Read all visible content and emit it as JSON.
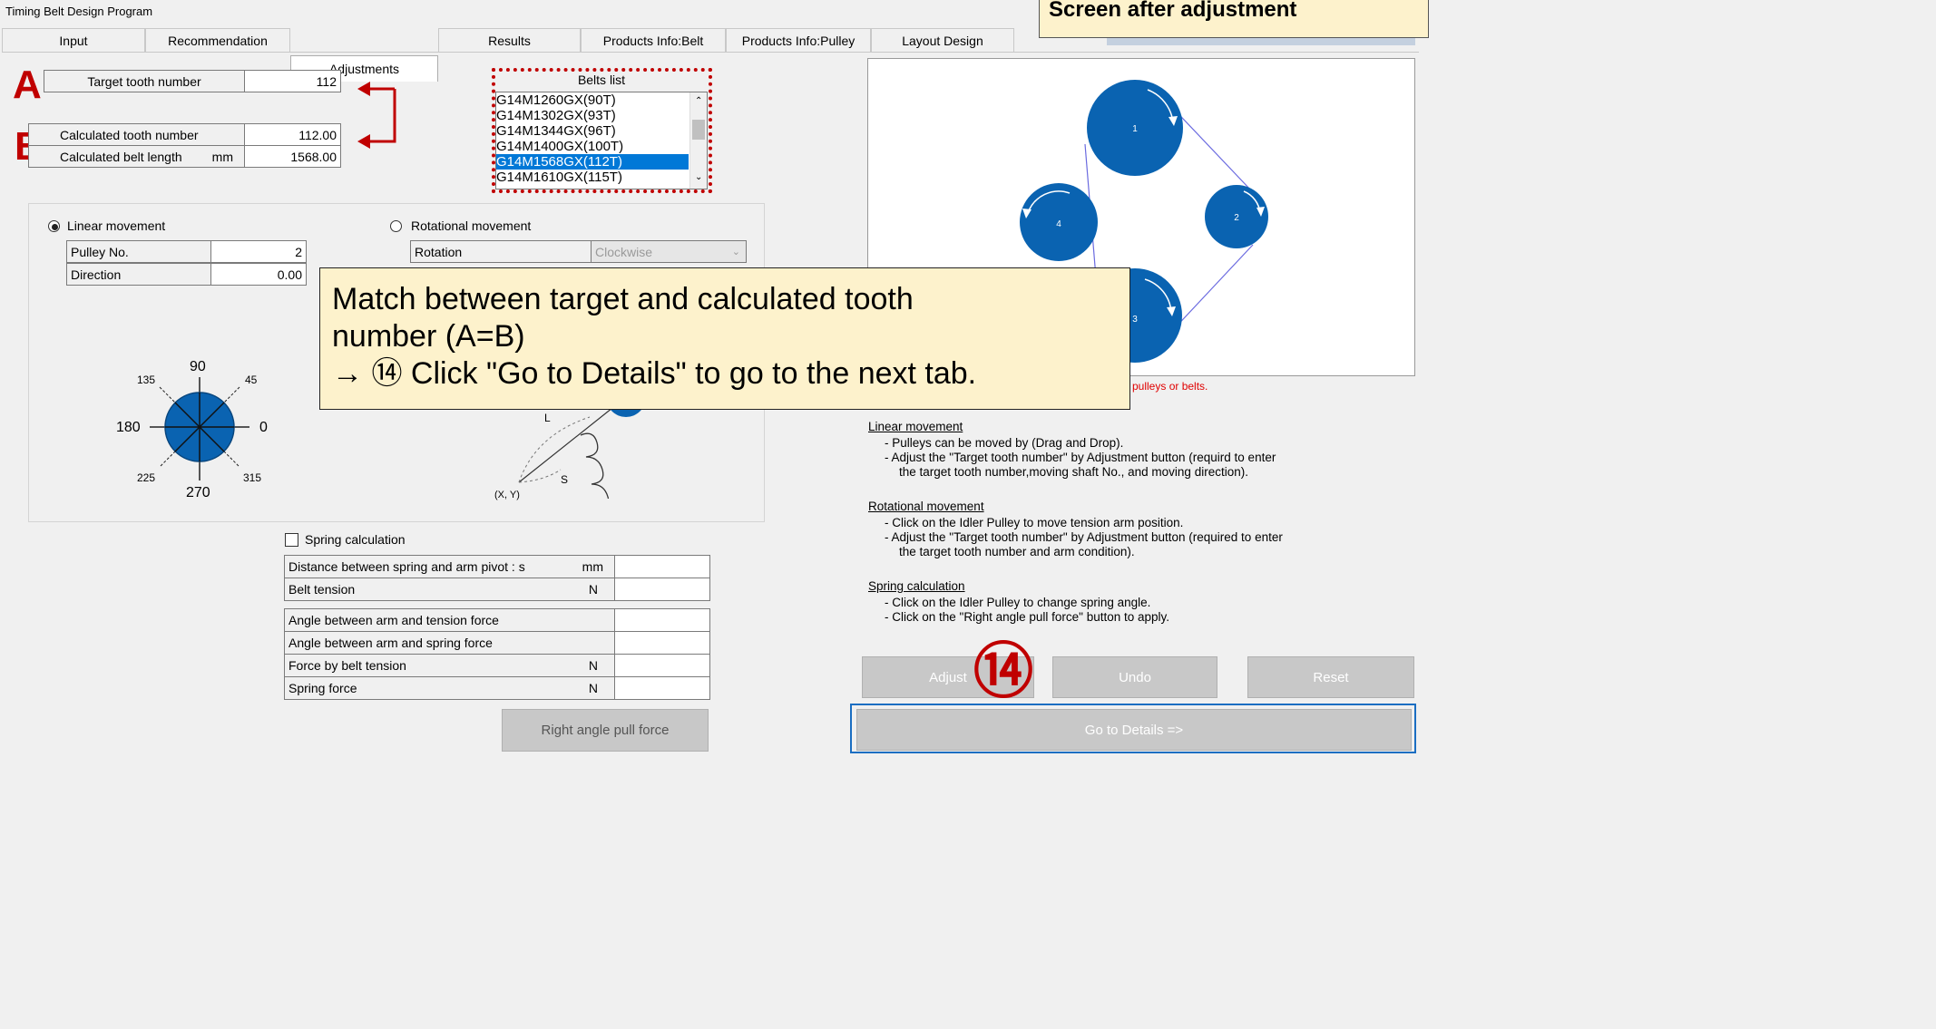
{
  "window": {
    "title": "Timing Belt Design Program"
  },
  "header_banner": "Screen after adjustment",
  "tabs": [
    "Input",
    "Recommendation",
    "Adjustments",
    "Results",
    "Products Info:Belt",
    "Products Info:Pulley",
    "Layout Design"
  ],
  "active_tab": "Adjustments",
  "markers": {
    "a": "A",
    "b": "B",
    "step": "⑭"
  },
  "target": {
    "label": "Target tooth number",
    "value": "112"
  },
  "calculated": {
    "tooth_label": "Calculated tooth number",
    "tooth_value": "112.00",
    "length_label": "Calculated belt length",
    "length_unit": "mm",
    "length_value": "1568.00"
  },
  "belts_list": {
    "title": "Belts list",
    "items": [
      "G14M1260GX(90T)",
      "G14M1302GX(93T)",
      "G14M1344GX(96T)",
      "G14M1400GX(100T)",
      "G14M1568GX(112T)",
      "G14M1610GX(115T)"
    ],
    "selected": "G14M1568GX(112T)"
  },
  "linear": {
    "label": "Linear movement",
    "selected": true,
    "pulley_label": "Pulley No.",
    "pulley_value": "2",
    "direction_label": "Direction",
    "direction_value": "0.00"
  },
  "rotational": {
    "label": "Rotational movement",
    "selected": false,
    "rotation_label": "Rotation",
    "rotation_value": "Clockwise"
  },
  "compass": {
    "n": "90",
    "ne": "45",
    "e": "0",
    "se": "315",
    "s": "270",
    "sw": "225",
    "w": "180",
    "nw": "135"
  },
  "arm_diagram": {
    "l": "L",
    "s": "S",
    "xy": "(X, Y)"
  },
  "spring": {
    "checkbox_label": "Spring calculation",
    "rows1": [
      {
        "label": "Distance between spring and arm pivot : s",
        "unit": "mm"
      },
      {
        "label": "Belt tension",
        "unit": "N"
      }
    ],
    "rows2": [
      {
        "label": "Angle between arm and tension force",
        "unit": ""
      },
      {
        "label": "Angle between arm and spring force",
        "unit": ""
      },
      {
        "label": "Force by belt tension",
        "unit": "N"
      },
      {
        "label": "Spring force",
        "unit": "N"
      }
    ],
    "button": "Right angle pull force"
  },
  "layout": {
    "pulleys": [
      "1",
      "2",
      "3",
      "4"
    ],
    "warning": "pulleys or belts."
  },
  "callout": {
    "line1": "Match between target and calculated tooth",
    "line2": "number (A=B)",
    "line3": "→ ⑭ Click \"Go to Details\" to go to the next tab."
  },
  "help": {
    "linear_title": "Linear movement",
    "linear_1": "- Pulleys can be moved by (Drag and Drop).",
    "linear_2": "- Adjust the \"Target tooth number\" by Adjustment button (requird to enter",
    "linear_3": "the target tooth number,moving shaft No., and moving direction).",
    "rot_title": "Rotational movement",
    "rot_1": "- Click on the Idler Pulley to move tension arm position.",
    "rot_2": "- Adjust the \"Target tooth number\" by Adjustment button (required to enter",
    "rot_3": "the target tooth number and arm condition).",
    "spring_title": "Spring calculation",
    "spring_1": "- Click on the Idler Pulley to change spring angle.",
    "spring_2": "- Click on the \"Right angle pull force\" button to apply."
  },
  "buttons": {
    "adjust": "Adjust",
    "undo": "Undo",
    "reset": "Reset",
    "details": "Go to Details =>"
  },
  "colors": {
    "pulley": "#0a63b1",
    "belt": "#6a6ae0",
    "callout_bg": "#fdf2cc",
    "marker": "#c00000",
    "selection": "#0078d7"
  }
}
